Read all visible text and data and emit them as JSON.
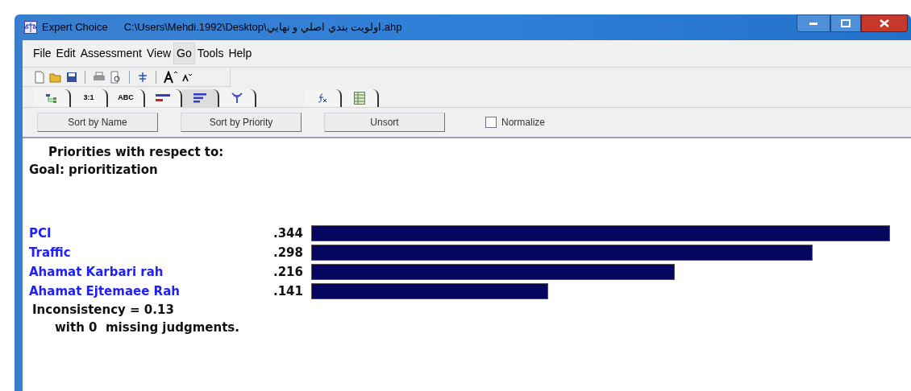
{
  "window": {
    "title": "Expert Choice",
    "path": "C:\\Users\\Mehdi.1992\\Desktop\\اولويت بندي اصلي و نهايي.ahp"
  },
  "menu": [
    {
      "label": "File",
      "selected": false
    },
    {
      "label": "Edit",
      "selected": false
    },
    {
      "label": "Assessment",
      "selected": false
    },
    {
      "label": "View",
      "selected": false
    },
    {
      "label": "Go",
      "selected": true
    },
    {
      "label": "Tools",
      "selected": false
    },
    {
      "label": "Help",
      "selected": false
    }
  ],
  "tabs": [
    {
      "kind": "tree",
      "selected": false
    },
    {
      "kind": "text",
      "label": "3:1",
      "selected": false
    },
    {
      "kind": "text",
      "label": "ABC",
      "selected": false
    },
    {
      "kind": "bars-red",
      "selected": false
    },
    {
      "kind": "bars",
      "selected": true
    },
    {
      "kind": "fork",
      "selected": false
    },
    {
      "kind": "gap"
    },
    {
      "kind": "formula",
      "selected": false
    },
    {
      "kind": "grid",
      "selected": false
    }
  ],
  "buttons": [
    "Sort by Name",
    "Sort by Priority",
    "Unsort"
  ],
  "normalize": {
    "label": "Normalize",
    "checked": false
  },
  "heading": "Priorities with respect to:",
  "goal": "Goal: prioritization",
  "priorities": [
    {
      "name": "PCI",
      "value": ".344"
    },
    {
      "name": "Traffic",
      "value": ".298"
    },
    {
      "name": "Ahamat Karbari rah",
      "value": ".216"
    },
    {
      "name": "Ahamat Ejtemaee Rah",
      "value": ".141"
    }
  ],
  "inconsistency": "Inconsistency = 0.13",
  "missing": "with 0  missing judgments."
}
